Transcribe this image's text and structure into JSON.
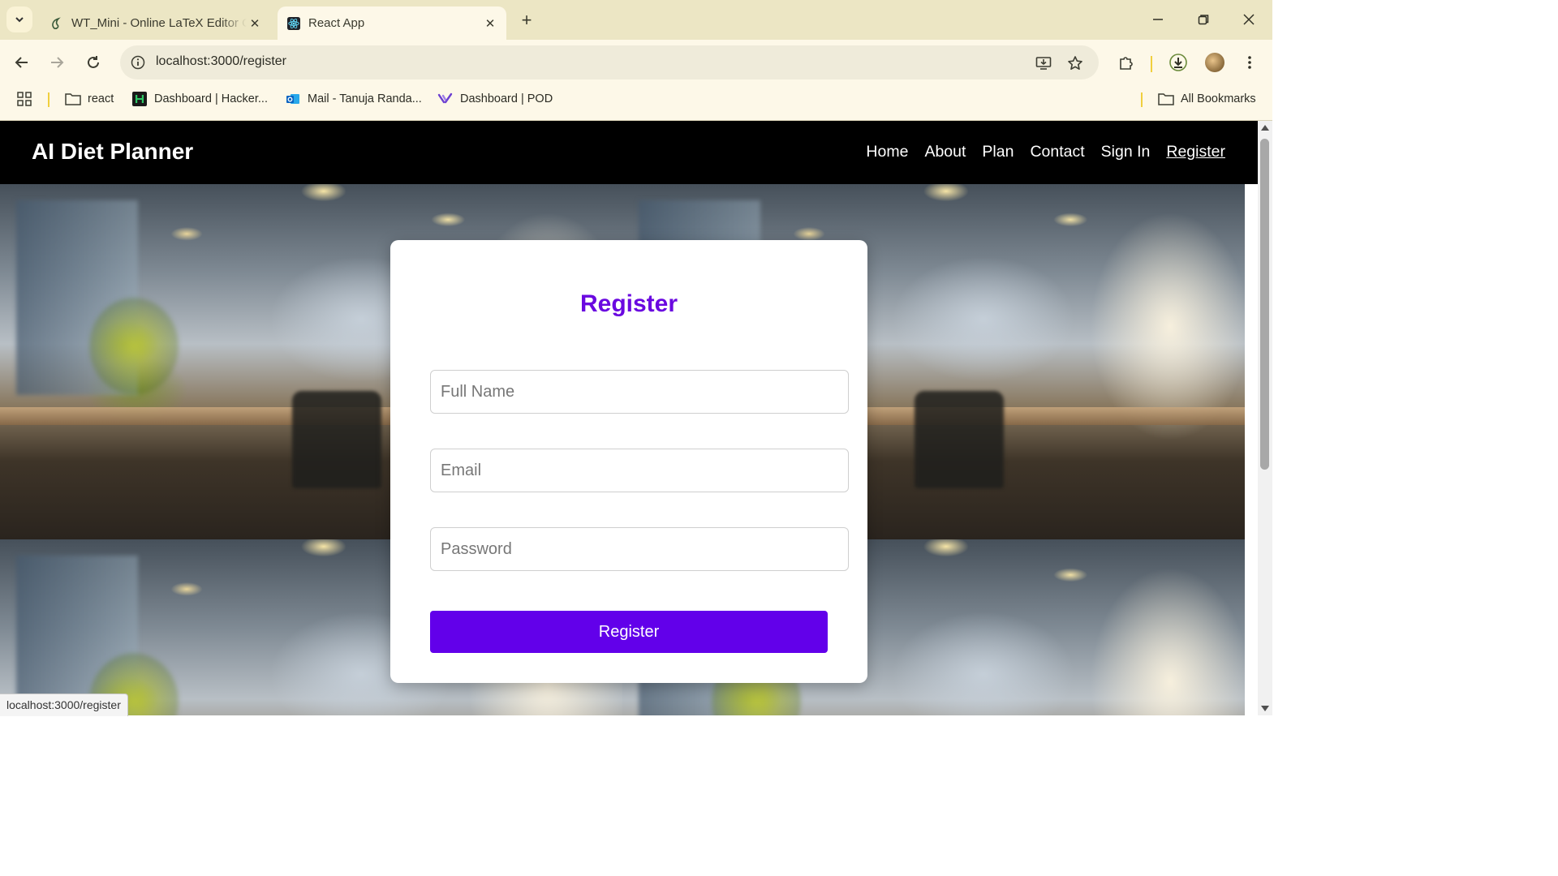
{
  "browser": {
    "tabs": [
      {
        "title": "WT_Mini - Online LaTeX Editor O",
        "favicon": "overleaf-icon",
        "active": false
      },
      {
        "title": "React App",
        "favicon": "react-icon",
        "active": true
      }
    ],
    "address": "localhost:3000/register",
    "bookmarks": [
      {
        "label": "react",
        "icon": "folder-icon"
      },
      {
        "label": "Dashboard | Hacker...",
        "icon": "hackerrank-icon"
      },
      {
        "label": "Mail - Tanuja Randa...",
        "icon": "outlook-icon"
      },
      {
        "label": "Dashboard | POD",
        "icon": "pod-icon"
      }
    ],
    "all_bookmarks": "All Bookmarks",
    "status_url": "localhost:3000/register"
  },
  "app": {
    "brand": "AI Diet Planner",
    "nav": [
      "Home",
      "About",
      "Plan",
      "Contact",
      "Sign In",
      "Register"
    ],
    "current_nav": "Register"
  },
  "form": {
    "title": "Register",
    "full_name_placeholder": "Full Name",
    "email_placeholder": "Email",
    "password_placeholder": "Password",
    "submit_label": "Register"
  },
  "colors": {
    "accent": "#6200ea",
    "title": "#6a08e0",
    "navbar": "#000000",
    "tabstrip": "#ece6c4",
    "toolbar": "#fdf8e8"
  }
}
